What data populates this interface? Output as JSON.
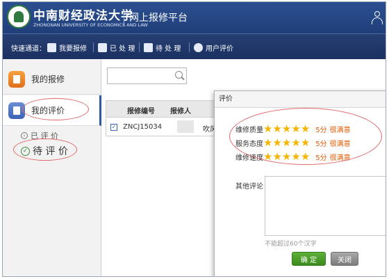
{
  "header": {
    "university_cn": "中南财经政法大学",
    "university_en": "ZHONGNAN UNIVERSITY OF ECONOMICS AND LAW",
    "system_title": "网上报修平台"
  },
  "quickbar": {
    "label": "快速通道：",
    "items": [
      {
        "label": "我要报修",
        "icon": "repair-icon"
      },
      {
        "label": "已 处 理",
        "icon": "processed-icon"
      },
      {
        "label": "待 处 理",
        "icon": "pending-icon"
      },
      {
        "label": "用户评价",
        "icon": "speech-bubble-icon"
      }
    ]
  },
  "sidebar": {
    "items": [
      {
        "label": "我的报修"
      },
      {
        "label": "我的评价"
      }
    ],
    "sub_items": [
      {
        "label": "已 评 价"
      },
      {
        "label": "待 评 价"
      }
    ]
  },
  "search": {
    "value": "",
    "placeholder": ""
  },
  "table": {
    "headers": [
      "报修编号",
      "报修人"
    ],
    "rows": [
      {
        "checked": true,
        "id": "ZNCJ15034",
        "reporter": "",
        "extra": "吹风"
      }
    ]
  },
  "dialog": {
    "title": "评价",
    "ratings": [
      {
        "label": "维修质量",
        "stars": 5,
        "score": "5分",
        "text": "很满意"
      },
      {
        "label": "服务态度",
        "stars": 5,
        "score": "5分",
        "text": "很满意"
      },
      {
        "label": "维修速度",
        "stars": 5,
        "score": "5分",
        "text": "很满意"
      }
    ],
    "other_label": "其他评论",
    "comment_value": "",
    "hint": "不能超过60个汉字",
    "ok_label": "确  定",
    "close_label": "关闭"
  },
  "colors": {
    "header_bg": "#1f3f7a",
    "star": "#f5b400",
    "score_text": "#e05a00",
    "ok_button": "#3b8a1e",
    "annotation": "#e06a6a"
  }
}
